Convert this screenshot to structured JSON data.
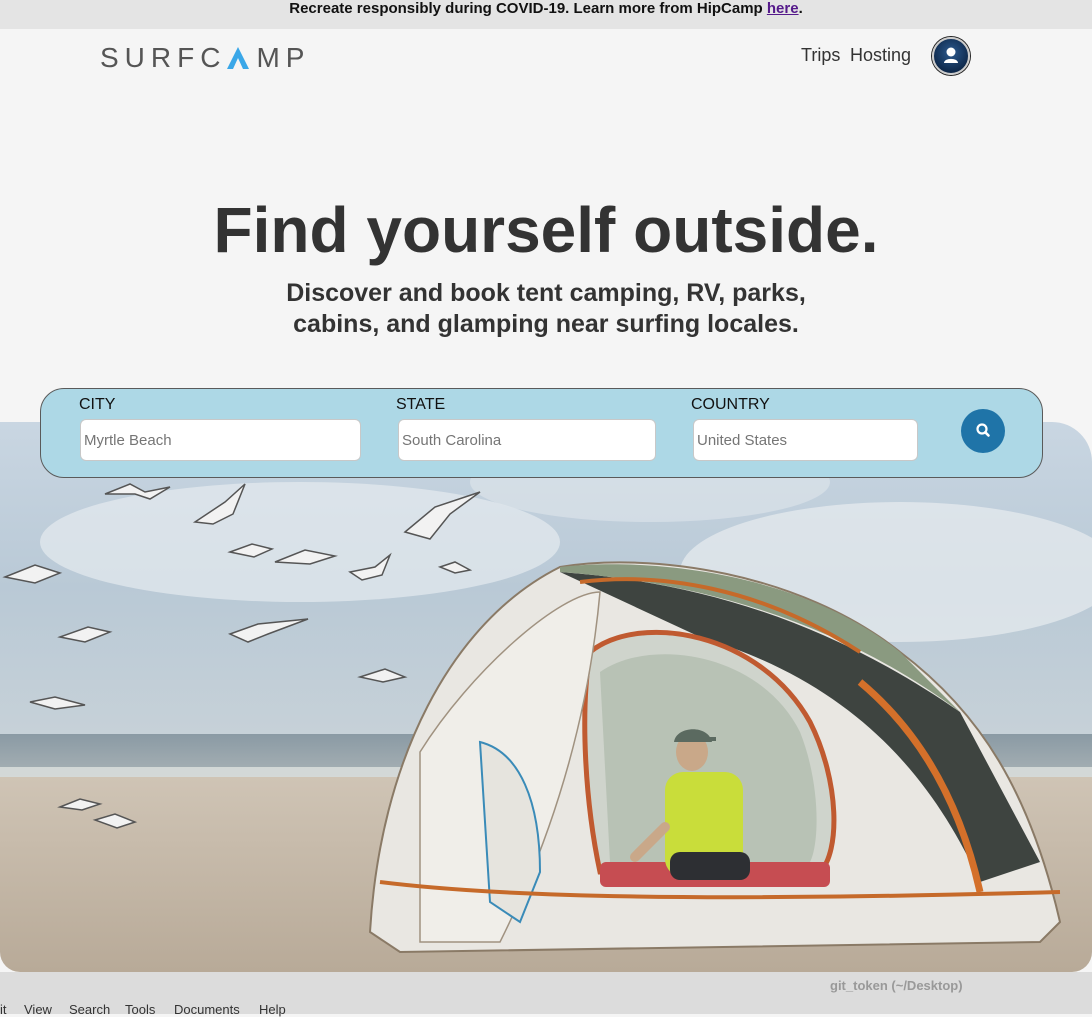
{
  "banner": {
    "text": "Recreate responsibly during COVID-19. Learn more from HipCamp ",
    "link": "here",
    "period": "."
  },
  "nav": {
    "logo": "SURFCAMP",
    "links": [
      "Trips",
      "Hosting"
    ]
  },
  "hero": {
    "title": "Find yourself outside.",
    "subtitle_line1": "Discover and book tent camping, RV, parks,",
    "subtitle_line2": "cabins, and glamping near surfing locales."
  },
  "search": {
    "city_label": "CITY",
    "city_placeholder": "Myrtle Beach",
    "state_label": "STATE",
    "state_placeholder": "South Carolina",
    "country_label": "COUNTRY",
    "country_placeholder": "United States",
    "button_icon": "search-icon"
  },
  "taskbar": {
    "window_title": "git_token (~/Desktop)",
    "menu": [
      "it",
      "View",
      "Search",
      "Tools",
      "Documents",
      "Help"
    ]
  },
  "colors": {
    "search_panel": "#add8e6",
    "search_button": "#1f74a8",
    "link": "#551a8b"
  }
}
